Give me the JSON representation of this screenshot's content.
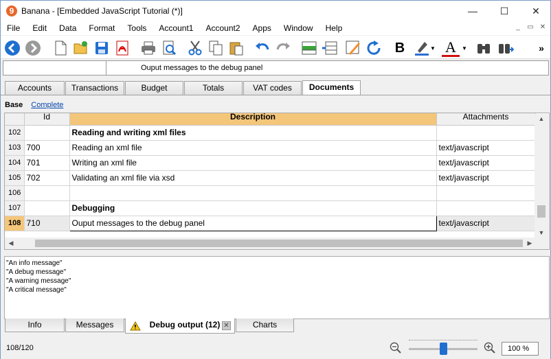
{
  "window": {
    "app_name": "Banana",
    "title": "Banana - [Embedded JavaScript Tutorial (*)]",
    "minimize_glyph": "—",
    "maximize_glyph": "☐",
    "close_glyph": "✕"
  },
  "menu": [
    "File",
    "Edit",
    "Data",
    "Format",
    "Tools",
    "Account1",
    "Account2",
    "Apps",
    "Window",
    "Help"
  ],
  "mdi_controls": [
    "_",
    "▭",
    "✕"
  ],
  "toolbar_icons": [
    "back-icon",
    "forward-icon",
    "new-file-icon",
    "open-folder-icon",
    "save-icon",
    "pdf-icon",
    "print-icon",
    "print-preview-icon",
    "cut-icon",
    "copy-icon",
    "paste-icon",
    "undo-icon",
    "redo-icon",
    "add-row-icon",
    "insert-row-icon",
    "edit-icon",
    "recheck-icon",
    "bold-icon",
    "highlight-color-icon",
    "text-color-icon",
    "find-icon",
    "find-next-icon",
    "more-icon"
  ],
  "toolbar": {
    "bold_glyph": "B",
    "text_color_glyph": "A",
    "more_glyph": "»"
  },
  "accent_colors": {
    "header_highlight": "#f4c67a",
    "nav_blue": "#1f6fd0",
    "highlight_blue": "#2c6fd1",
    "text_color_red": "#d01010"
  },
  "cell_bar": {
    "cell_ref": "",
    "content": "Ouput messages to the debug panel"
  },
  "tabs": [
    {
      "label": "Accounts",
      "active": false
    },
    {
      "label": "Transactions",
      "active": false
    },
    {
      "label": "Budget",
      "active": false
    },
    {
      "label": "Totals",
      "active": false
    },
    {
      "label": "VAT codes",
      "active": false
    },
    {
      "label": "Documents",
      "active": true
    }
  ],
  "views": {
    "base": "Base",
    "complete": "Complete"
  },
  "table": {
    "columns": [
      "",
      "Id",
      "Description",
      "Attachments"
    ],
    "rows": [
      {
        "num": "102",
        "id": "",
        "description": "Reading and writing xml files",
        "attachments": "",
        "bold": true
      },
      {
        "num": "103",
        "id": "700",
        "description": "Reading an xml file",
        "attachments": "text/javascript",
        "bold": false
      },
      {
        "num": "104",
        "id": "701",
        "description": "Writing an xml file",
        "attachments": "text/javascript",
        "bold": false
      },
      {
        "num": "105",
        "id": "702",
        "description": "Validating an xml file via xsd",
        "attachments": "text/javascript",
        "bold": false
      },
      {
        "num": "106",
        "id": "",
        "description": "",
        "attachments": "",
        "bold": false
      },
      {
        "num": "107",
        "id": "",
        "description": "Debugging",
        "attachments": "",
        "bold": true
      },
      {
        "num": "108",
        "id": "710",
        "description": "Ouput messages to the debug panel",
        "attachments": "text/javascript",
        "bold": false,
        "selected": true
      }
    ]
  },
  "output_lines": [
    "\"An info message\"",
    "\"A debug message\"",
    "\"A warning message\"",
    "\"A critical message\""
  ],
  "bottom_tabs": [
    {
      "label": "Info",
      "active": false
    },
    {
      "label": "Messages",
      "active": false
    },
    {
      "label": "Debug output (12)",
      "active": true
    },
    {
      "label": "Charts",
      "active": false
    }
  ],
  "status": {
    "row_count": "108/120",
    "zoom": "100 %",
    "zoom_level": 0.5
  }
}
